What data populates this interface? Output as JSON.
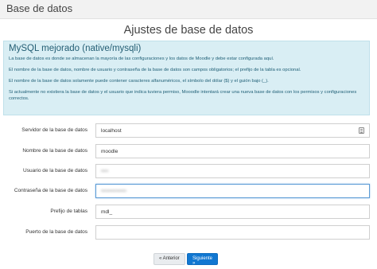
{
  "app": {
    "title": "Base de datos"
  },
  "page": {
    "heading": "Ajustes de base de datos"
  },
  "info": {
    "title": "MySQL mejorado (native/mysqli)",
    "paragraphs": [
      "La base de datos es donde se almacenan la mayoría de las configuraciones y los datos de Moodle y debe estar configurada aquí.",
      "El nombre de la base de datos, nombre de usuario y contraseña de la base de datos son campos obligatorios; el prefijo de la tabla es opcional.",
      "El nombre de la base de datos solamente puede contener caracteres alfanuméricos, el símbolo del dólar ($) y el guión bajo (_).",
      "Si actualmente no existiera la base de datos y el usuario que indica tuviera permiso, Mooodle intentará crear una nueva base de datos con los permisos y configuraciones correctos."
    ]
  },
  "form": {
    "host": {
      "label": "Servidor de la base de datos",
      "value": "localhost"
    },
    "dbname": {
      "label": "Nombre de la base de datos",
      "value": "moodle"
    },
    "user": {
      "label": "Usuario de la base de datos",
      "value": "••••"
    },
    "password": {
      "label": "Contraseña de la base de datos",
      "value": "••••••••••••••"
    },
    "prefix": {
      "label": "Prefijo de tablas",
      "value": "mdl_"
    },
    "port": {
      "label": "Puerto de la base de datos",
      "value": ""
    }
  },
  "buttons": {
    "prev": "« Anterior",
    "next": "Siguiente »"
  }
}
